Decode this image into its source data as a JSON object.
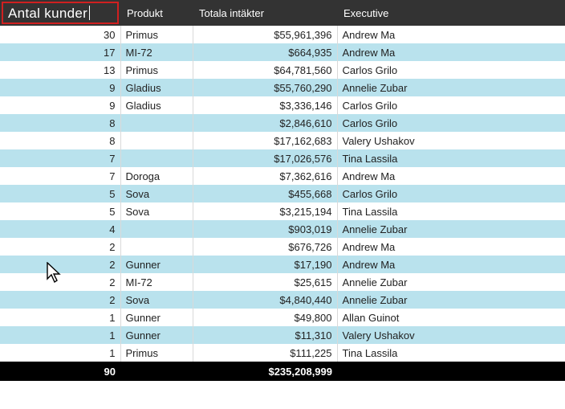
{
  "columns": {
    "count_label_edit": "Antal kunder",
    "product": "Produkt",
    "revenue": "Totala intäkter",
    "executive": "Executive"
  },
  "rows": [
    {
      "count": "30",
      "product": "Primus",
      "revenue": "$55,961,396",
      "exec": "Andrew Ma"
    },
    {
      "count": "17",
      "product": "MI-72",
      "revenue": "$664,935",
      "exec": "Andrew Ma"
    },
    {
      "count": "13",
      "product": "Primus",
      "revenue": "$64,781,560",
      "exec": "Carlos Grilo"
    },
    {
      "count": "9",
      "product": "Gladius",
      "revenue": "$55,760,290",
      "exec": "Annelie Zubar"
    },
    {
      "count": "9",
      "product": "Gladius",
      "revenue": "$3,336,146",
      "exec": "Carlos Grilo"
    },
    {
      "count": "8",
      "product": "",
      "revenue": "$2,846,610",
      "exec": "Carlos Grilo"
    },
    {
      "count": "8",
      "product": "",
      "revenue": "$17,162,683",
      "exec": "Valery Ushakov"
    },
    {
      "count": "7",
      "product": "",
      "revenue": "$17,026,576",
      "exec": "Tina Lassila"
    },
    {
      "count": "7",
      "product": "Doroga",
      "revenue": "$7,362,616",
      "exec": "Andrew Ma"
    },
    {
      "count": "5",
      "product": "Sova",
      "revenue": "$455,668",
      "exec": "Carlos Grilo"
    },
    {
      "count": "5",
      "product": "Sova",
      "revenue": "$3,215,194",
      "exec": "Tina Lassila"
    },
    {
      "count": "4",
      "product": "",
      "revenue": "$903,019",
      "exec": "Annelie Zubar"
    },
    {
      "count": "2",
      "product": "",
      "revenue": "$676,726",
      "exec": "Andrew Ma"
    },
    {
      "count": "2",
      "product": "Gunner",
      "revenue": "$17,190",
      "exec": "Andrew Ma"
    },
    {
      "count": "2",
      "product": "MI-72",
      "revenue": "$25,615",
      "exec": "Annelie Zubar"
    },
    {
      "count": "2",
      "product": "Sova",
      "revenue": "$4,840,440",
      "exec": "Annelie Zubar"
    },
    {
      "count": "1",
      "product": "Gunner",
      "revenue": "$49,800",
      "exec": "Allan Guinot"
    },
    {
      "count": "1",
      "product": "Gunner",
      "revenue": "$11,310",
      "exec": "Valery Ushakov"
    },
    {
      "count": "1",
      "product": "Primus",
      "revenue": "$111,225",
      "exec": "Tina Lassila"
    }
  ],
  "totals": {
    "count": "90",
    "revenue": "$235,208,999"
  }
}
